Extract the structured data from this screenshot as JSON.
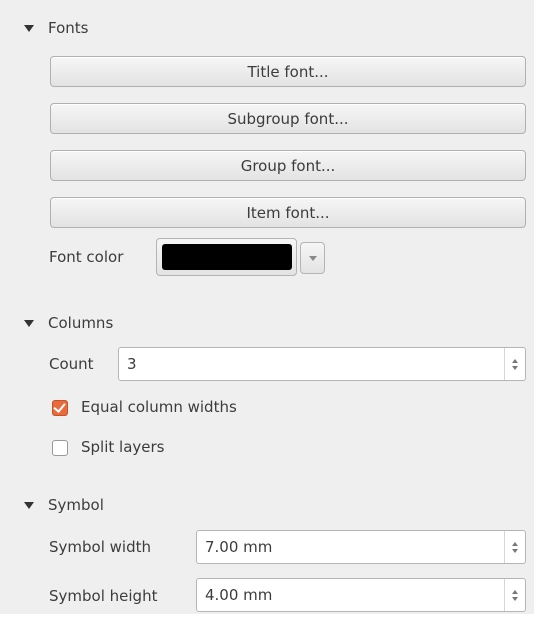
{
  "fonts": {
    "header": "Fonts",
    "buttons": [
      "Title font...",
      "Subgroup font...",
      "Group font...",
      "Item font..."
    ],
    "color_label": "Font color",
    "color_value": "#000000"
  },
  "columns": {
    "header": "Columns",
    "count_label": "Count",
    "count_value": "3",
    "equal_widths_label": "Equal column widths",
    "equal_widths_checked": true,
    "split_layers_label": "Split layers",
    "split_layers_checked": false
  },
  "symbol": {
    "header": "Symbol",
    "width_label": "Symbol width",
    "width_value": "7.00 mm",
    "height_label": "Symbol height",
    "height_value": "4.00 mm"
  },
  "colors": {
    "panel_bg": "#efefef",
    "accent": "#e96a3c"
  }
}
